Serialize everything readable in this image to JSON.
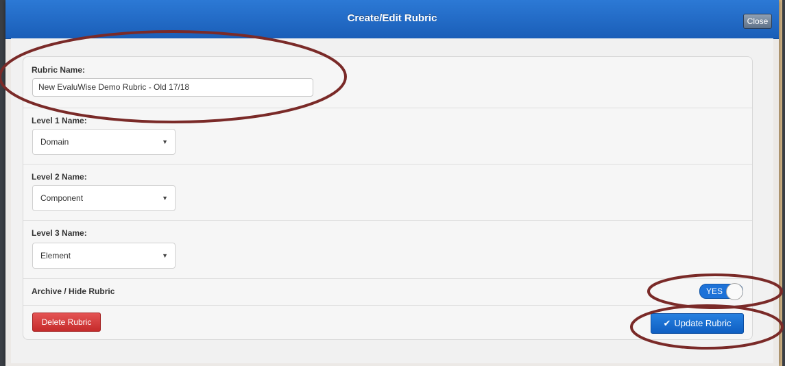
{
  "dialog": {
    "title": "Create/Edit Rubric",
    "close_label": "Close"
  },
  "form": {
    "rubric_name_label": "Rubric Name:",
    "rubric_name_value": "New EvaluWise Demo Rubric - Old 17/18",
    "level1_label": "Level 1 Name:",
    "level1_value": "Domain",
    "level2_label": "Level 2 Name:",
    "level2_value": "Component",
    "level3_label": "Level 3 Name:",
    "level3_value": "Element",
    "archive_label": "Archive / Hide Rubric",
    "archive_toggle_label": "YES",
    "delete_label": "Delete Rubric",
    "update_label": "Update Rubric"
  },
  "colors": {
    "titlebar": "#1f66c2",
    "primary_button": "#1565c8",
    "danger_button": "#d23a3a",
    "annotation_ellipse": "#7a2a28"
  },
  "icons": {
    "dropdown": "chevron-down-icon",
    "update": "check-icon"
  }
}
